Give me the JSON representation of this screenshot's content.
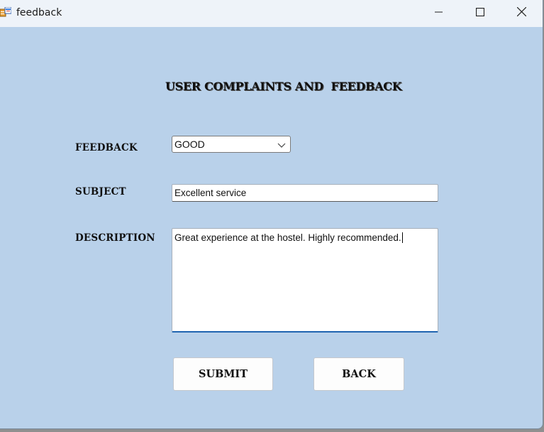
{
  "window": {
    "title": "feedback",
    "icon": "app-form-icon",
    "controls": [
      "minimize-icon",
      "maximize-icon",
      "close-icon"
    ]
  },
  "form": {
    "heading": "USER COMPLAINTS AND  FEEDBACK",
    "feedback_label": "FEEDBACK",
    "feedback_value": "GOOD",
    "subject_label": "SUBJECT",
    "subject_value": "Excellent service",
    "description_label": "DESCRIPTION",
    "description_value": "Great experience at the hostel. Highly recommended."
  },
  "buttons": {
    "submit_label": "SUBMIT",
    "back_label": "BACK"
  },
  "colors": {
    "form_background": "#b9d1ea",
    "focus_border": "#1f64b0"
  }
}
